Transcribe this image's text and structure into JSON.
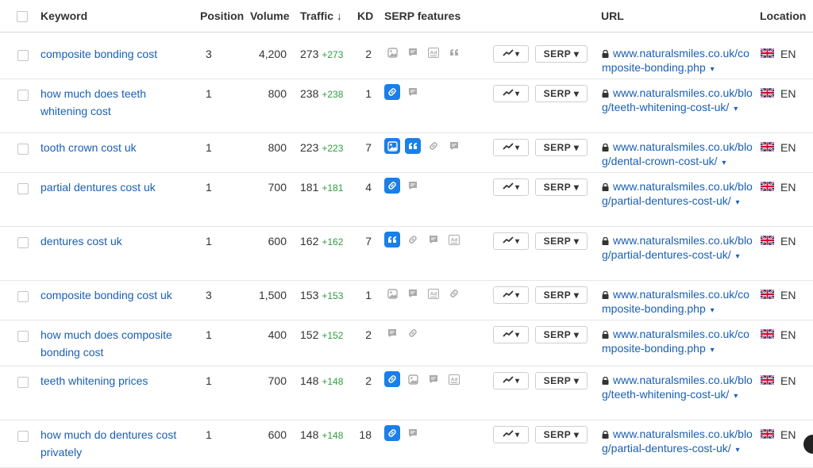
{
  "header": {
    "keyword": "Keyword",
    "position": "Position",
    "volume": "Volume",
    "traffic": "Traffic ↓",
    "kd": "KD",
    "serp_features": "SERP features",
    "url": "URL",
    "location": "Location"
  },
  "buttons": {
    "trend_symbol": "▾",
    "serp_label": "SERP ▾"
  },
  "rows": [
    {
      "keyword": "composite bonding cost",
      "position": "3",
      "volume": "4,200",
      "traffic": "273",
      "delta": "+273",
      "kd": "2",
      "features": [
        [
          "image",
          0
        ],
        [
          "snippet",
          0
        ],
        [
          "ad",
          0
        ],
        [
          "quote",
          0
        ]
      ],
      "url": "www.naturalsmiles.co.uk/composite-bonding.php",
      "location": "EN"
    },
    {
      "keyword": "how much does teeth whitening cost",
      "position": "1",
      "volume": "800",
      "traffic": "238",
      "delta": "+238",
      "kd": "1",
      "features": [
        [
          "link",
          1
        ],
        [
          "snippet",
          0
        ]
      ],
      "url": "www.naturalsmiles.co.uk/blog/teeth-whitening-cost-uk/",
      "location": "EN"
    },
    {
      "keyword": "tooth crown cost uk",
      "position": "1",
      "volume": "800",
      "traffic": "223",
      "delta": "+223",
      "kd": "7",
      "features": [
        [
          "image",
          1
        ],
        [
          "quote",
          1
        ],
        [
          "link",
          0
        ],
        [
          "snippet",
          0
        ]
      ],
      "url": "www.naturalsmiles.co.uk/blog/dental-crown-cost-uk/",
      "location": "EN"
    },
    {
      "keyword": "partial dentures cost uk",
      "position": "1",
      "volume": "700",
      "traffic": "181",
      "delta": "+181",
      "kd": "4",
      "features": [
        [
          "link",
          1
        ],
        [
          "snippet",
          0
        ]
      ],
      "url": "www.naturalsmiles.co.uk/blog/partial-dentures-cost-uk/",
      "location": "EN"
    },
    {
      "keyword": "dentures cost uk",
      "position": "1",
      "volume": "600",
      "traffic": "162",
      "delta": "+162",
      "kd": "7",
      "features": [
        [
          "quote",
          1
        ],
        [
          "link",
          0
        ],
        [
          "snippet",
          0
        ],
        [
          "ad",
          0
        ]
      ],
      "url": "www.naturalsmiles.co.uk/blog/partial-dentures-cost-uk/",
      "location": "EN"
    },
    {
      "keyword": "composite bonding cost uk",
      "position": "3",
      "volume": "1,500",
      "traffic": "153",
      "delta": "+153",
      "kd": "1",
      "features": [
        [
          "image",
          0
        ],
        [
          "snippet",
          0
        ],
        [
          "ad",
          0
        ],
        [
          "link",
          0
        ]
      ],
      "url": "www.naturalsmiles.co.uk/composite-bonding.php",
      "location": "EN"
    },
    {
      "keyword": "how much does composite bonding cost",
      "position": "1",
      "volume": "400",
      "traffic": "152",
      "delta": "+152",
      "kd": "2",
      "features": [
        [
          "snippet",
          0
        ],
        [
          "link",
          0
        ]
      ],
      "url": "www.naturalsmiles.co.uk/composite-bonding.php",
      "location": "EN"
    },
    {
      "keyword": "teeth whitening prices",
      "position": "1",
      "volume": "700",
      "traffic": "148",
      "delta": "+148",
      "kd": "2",
      "features": [
        [
          "link",
          1
        ],
        [
          "image",
          0
        ],
        [
          "snippet",
          0
        ],
        [
          "ad",
          0
        ]
      ],
      "url": "www.naturalsmiles.co.uk/blog/teeth-whitening-cost-uk/",
      "location": "EN"
    },
    {
      "keyword": "how much do dentures cost privately",
      "position": "1",
      "volume": "600",
      "traffic": "148",
      "delta": "+148",
      "kd": "18",
      "features": [
        [
          "link",
          1
        ],
        [
          "snippet",
          0
        ]
      ],
      "url": "www.naturalsmiles.co.uk/blog/partial-dentures-cost-uk/",
      "location": "EN"
    }
  ],
  "colors": {
    "link": "#1a5fb4",
    "delta": "#2e9e3e",
    "feature_active": "#1a7fe8"
  }
}
